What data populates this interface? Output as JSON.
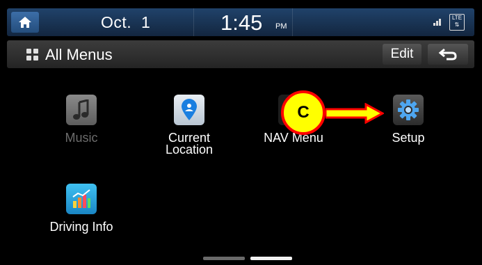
{
  "status_bar": {
    "home_icon": "home-icon",
    "date": "Oct.  1",
    "time": "1:45",
    "ampm": "PM",
    "signal_icon": "signal-icon",
    "lte_badge": "LTE"
  },
  "header": {
    "grid_icon": "grid-icon",
    "title": "All Menus",
    "edit_label": "Edit",
    "back_icon": "back-arrow-icon"
  },
  "menu_items": [
    {
      "label": "Music",
      "icon": "music-icon",
      "enabled": false
    },
    {
      "label_line1": "Current",
      "label_line2": "Location",
      "icon": "location-pin-icon",
      "enabled": true
    },
    {
      "label": "NAV Menu",
      "icon": "nav-menu-icon",
      "enabled": true
    },
    {
      "label": "Setup",
      "icon": "gear-icon",
      "enabled": true
    },
    {
      "label": "Driving Info",
      "icon": "bar-chart-icon",
      "enabled": true
    }
  ],
  "callout": {
    "letter": "C",
    "color": "#ffff00",
    "border": "#ff0000",
    "arrow_color": "#ff0000"
  },
  "pager": {
    "pages": 2,
    "current": 2
  }
}
